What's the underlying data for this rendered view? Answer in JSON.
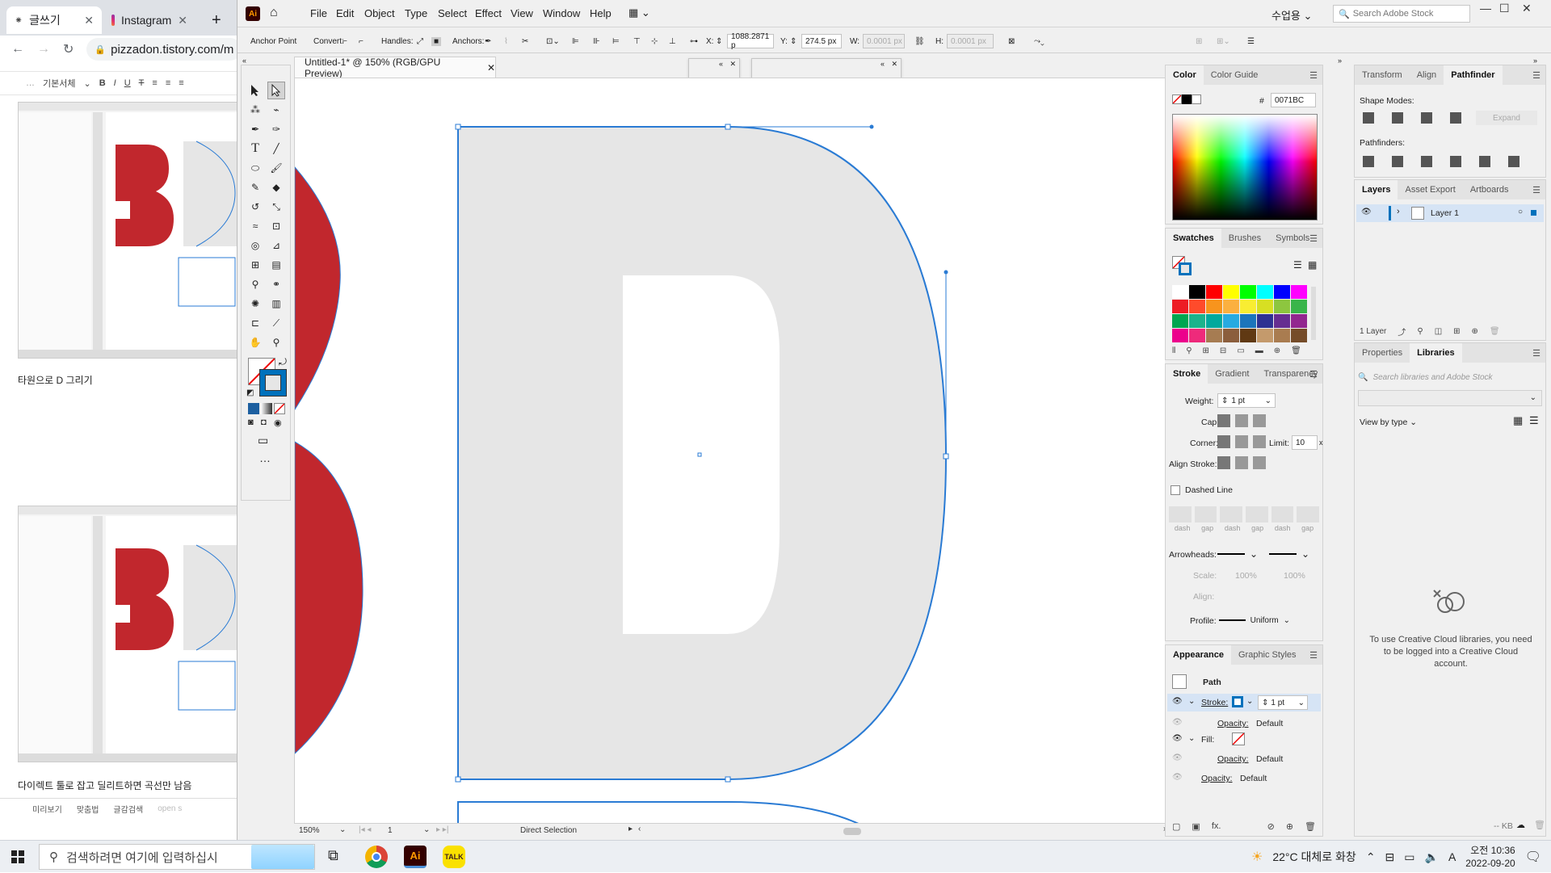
{
  "browser": {
    "tabs": [
      {
        "label": "글쓰기",
        "icon": "tistory-icon"
      },
      {
        "label": "Instagram",
        "icon": "instagram-icon"
      }
    ],
    "new_tab": "+",
    "url": "pizzadon.tistory.com/m",
    "editor_toolbar": {
      "style_select": "기본서체",
      "bold": "B",
      "italic": "I",
      "underline": "U",
      "strike": "T"
    },
    "captions": [
      "타원으로 D 그리기",
      "다이렉트 툴로 잡고 딜리트하면 곡선만 남음"
    ],
    "bottom": [
      "미리보기",
      "맞춤법",
      "글감검색",
      "open s"
    ]
  },
  "illustrator": {
    "logo": "Ai",
    "menus": [
      "File",
      "Edit",
      "Object",
      "Type",
      "Select",
      "Effect",
      "View",
      "Window",
      "Help"
    ],
    "lang": "수업용",
    "stock_search_placeholder": "Search Adobe Stock",
    "control": {
      "mode": "Anchor Point",
      "convert": "Convert:",
      "handles": "Handles:",
      "anchors": "Anchors:",
      "x_label": "X:",
      "x_value": "1088.2871 p",
      "y_label": "Y:",
      "y_value": "274.5 px",
      "w_label": "W:",
      "w_value": "0.0001 px",
      "h_label": "H:",
      "h_value": "0.0001 px"
    },
    "document_tab": "Untitled-1* @ 150% (RGB/GPU Preview)",
    "status": {
      "zoom": "150%",
      "artboard": "1",
      "tool": "Direct Selection"
    },
    "color_panel": {
      "tabs": [
        "Color",
        "Color Guide"
      ],
      "hex_label": "#",
      "hex": "0071BC"
    },
    "swatches_panel": {
      "tabs": [
        "Swatches",
        "Brushes",
        "Symbols"
      ]
    },
    "swatch_colors": [
      "#ffffff",
      "#000000",
      "#ff0000",
      "#ffff00",
      "#00ff00",
      "#00ffff",
      "#0000ff",
      "#ff00ff",
      "#ed1c24",
      "#ff4b2b",
      "#f7941d",
      "#fbb040",
      "#f9ed32",
      "#d7df23",
      "#8dc63f",
      "#39b54a",
      "#00a651",
      "#1bb38c",
      "#00a99d",
      "#27aae1",
      "#1c75bc",
      "#2e3192",
      "#662d91",
      "#92278f",
      "#ec008c",
      "#ee2a7b",
      "#a67c52",
      "#8b5e3c",
      "#603913",
      "#c49a6c",
      "#a97c50",
      "#754c29"
    ],
    "stroke_panel": {
      "tabs": [
        "Stroke",
        "Gradient",
        "Transparency"
      ],
      "weight_label": "Weight:",
      "weight": "1 pt",
      "cap_label": "Cap:",
      "corner_label": "Corner:",
      "limit_label": "Limit:",
      "limit": "10",
      "limit_unit": "x",
      "align_label": "Align Stroke:",
      "dashed": "Dashed Line",
      "dash_labels": [
        "dash",
        "gap",
        "dash",
        "gap",
        "dash",
        "gap"
      ],
      "arrowheads_label": "Arrowheads:",
      "scale_label": "Scale:",
      "scale1": "100%",
      "scale2": "100%",
      "align2_label": "Align:",
      "profile_label": "Profile:",
      "profile": "Uniform"
    },
    "appearance_panel": {
      "tabs": [
        "Appearance",
        "Graphic Styles"
      ],
      "object": "Path",
      "stroke_label": "Stroke:",
      "stroke_weight": "1 pt",
      "opacity_label": "Opacity:",
      "opacity_value": "Default",
      "fill_label": "Fill:",
      "opacity2_label": "Opacity:",
      "opacity2_value": "Default",
      "opacity3_label": "Opacity:",
      "opacity3_value": "Default"
    },
    "transform_panel": {
      "tabs": [
        "Transform",
        "Align",
        "Pathfinder"
      ],
      "shape_modes": "Shape Modes:",
      "expand": "Expand",
      "pathfinders": "Pathfinders:"
    },
    "layers_panel": {
      "tabs": [
        "Layers",
        "Asset Export",
        "Artboards"
      ],
      "layer": "Layer 1",
      "count": "1 Layer"
    },
    "libraries_panel": {
      "tabs": [
        "Properties",
        "Libraries"
      ],
      "search_placeholder": "Search libraries and Adobe Stock",
      "view_by": "View by type",
      "message": "To use Creative Cloud libraries, you need to be logged into a Creative Cloud account.",
      "size": "-- KB"
    },
    "colors": {
      "accent": "#0071BC",
      "letter_fill": "#e6e6e6",
      "red": "#c1272d",
      "path": "#2a7bd4"
    }
  },
  "taskbar": {
    "search_placeholder": "검색하려면 여기에 입력하십시",
    "weather": "22°C 대체로 화창",
    "ime": "A",
    "time": "오전 10:36",
    "date": "2022-09-20"
  }
}
